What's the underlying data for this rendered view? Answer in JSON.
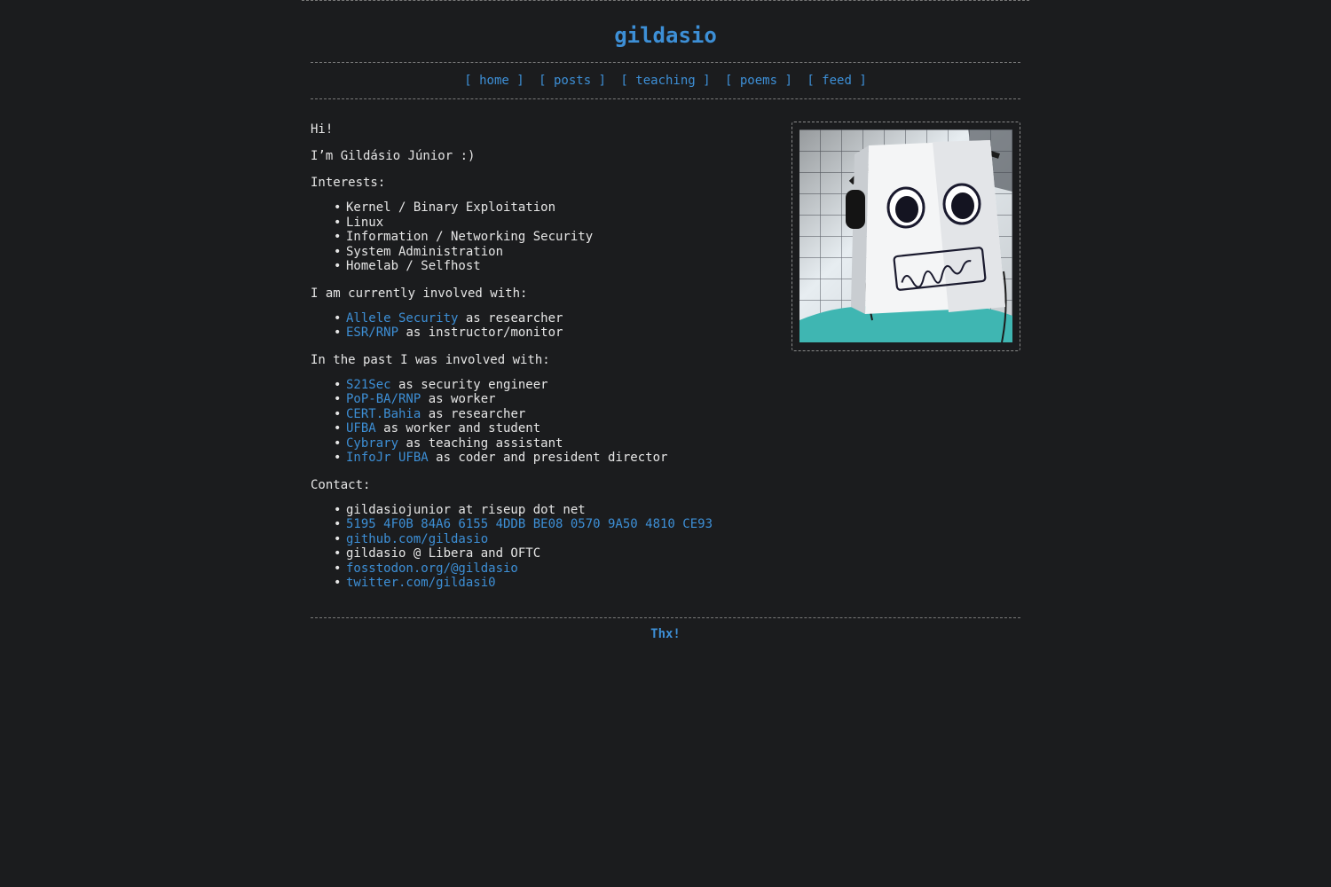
{
  "site": {
    "title": "gildasio"
  },
  "nav": [
    {
      "label": "[ home ]"
    },
    {
      "label": "[ posts ]"
    },
    {
      "label": "[ teaching ]"
    },
    {
      "label": "[ poems ]"
    },
    {
      "label": "[ feed ]"
    }
  ],
  "intro": {
    "greeting": "Hi!",
    "name_line": "I’m Gildásio Júnior :)"
  },
  "interests": {
    "heading": "Interests:",
    "items": [
      "Kernel / Binary Exploitation",
      "Linux",
      "Information / Networking Security",
      "System Administration",
      "Homelab / Selfhost"
    ]
  },
  "current": {
    "heading": "I am currently involved with:",
    "items": [
      {
        "link": "Allele Security",
        "text": " as researcher"
      },
      {
        "link": "ESR/RNP",
        "text": " as instructor/monitor"
      }
    ]
  },
  "past": {
    "heading": "In the past I was involved with:",
    "items": [
      {
        "link": "S21Sec",
        "text": " as security engineer"
      },
      {
        "link": "PoP-BA/RNP",
        "text": " as worker"
      },
      {
        "link": "CERT.Bahia",
        "text": " as researcher"
      },
      {
        "link": "UFBA",
        "text": " as worker and student"
      },
      {
        "link": "Cybrary",
        "text": " as teaching assistant"
      },
      {
        "link": "InfoJr UFBA",
        "text": " as coder and president director"
      }
    ]
  },
  "contact": {
    "heading": "Contact:",
    "email": "gildasiojunior at riseup dot net",
    "pgp": "5195 4F0B 84A6 6155 4DDB BE08 0570 9A50 4810 CE93",
    "github": "github.com/gildasio",
    "irc": "gildasio @ Libera and OFTC",
    "mastodon": "fosstodon.org/@gildasio",
    "twitter": "twitter.com/gildasi0"
  },
  "footer": {
    "text": "Thx!"
  },
  "colors": {
    "background": "#1b1c1e",
    "text": "#e6e6e6",
    "link": "#3d8fd6"
  }
}
